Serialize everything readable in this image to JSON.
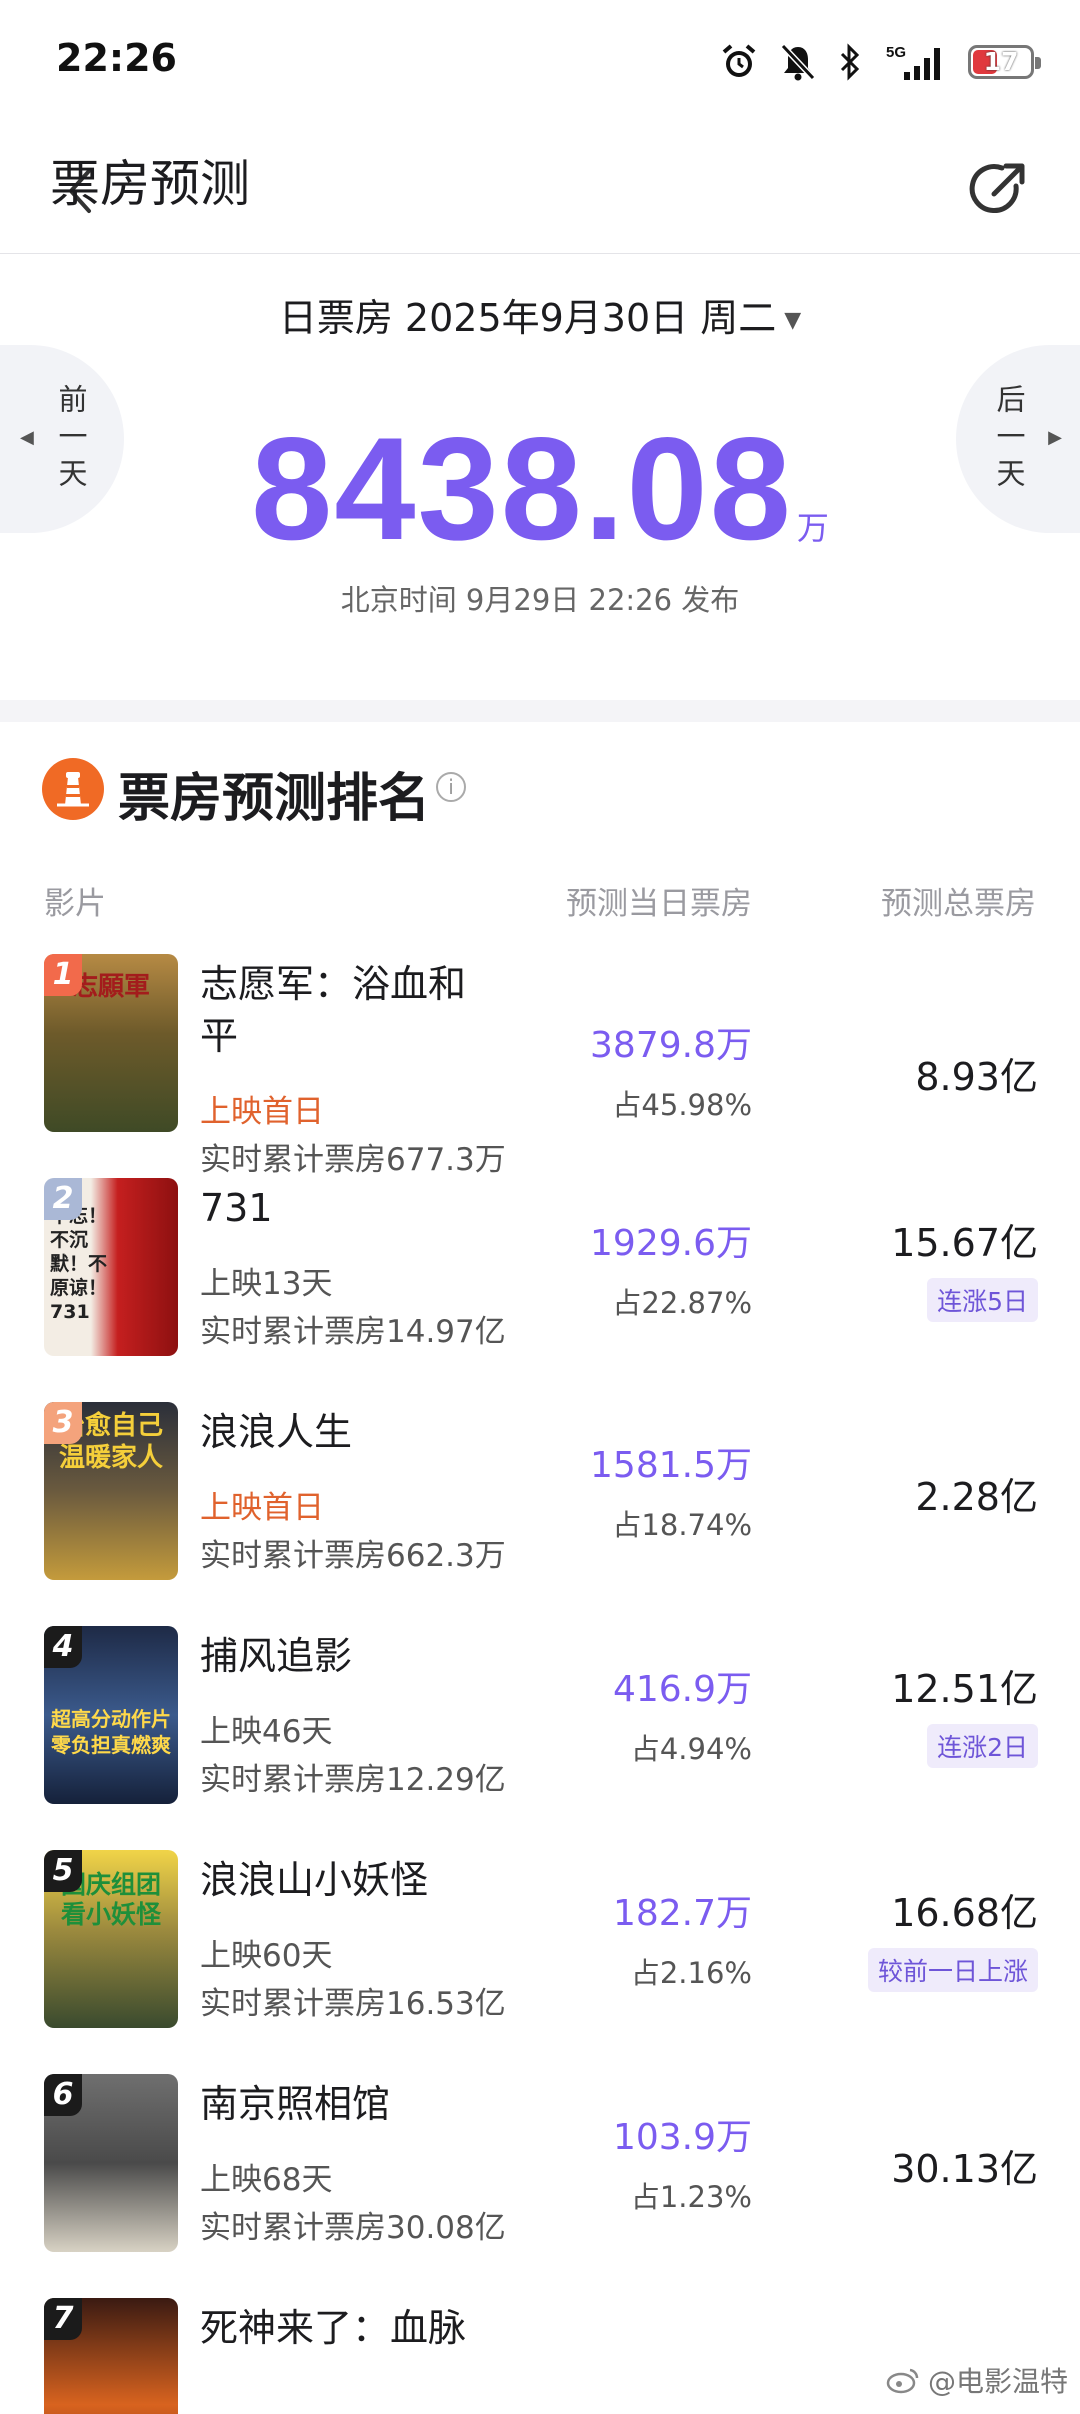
{
  "status_bar": {
    "time": "22:26",
    "network": "5G",
    "battery": "17"
  },
  "nav": {
    "title": "票房预测"
  },
  "summary": {
    "date_label": "日票房 2025年9月30日 周二",
    "prev_label": "前一天",
    "next_label": "后一天",
    "amount": "8438.08",
    "unit": "万",
    "publish_time": "北京时间 9月29日 22:26 发布"
  },
  "ranking": {
    "title": "票房预测排名",
    "col_film": "影片",
    "col_today": "预测当日票房",
    "col_total": "预测总票房",
    "items": [
      {
        "rank": "1",
        "title": "志愿军：浴血和平",
        "status": "上映首日",
        "cumulative": "实时累计票房677.3万",
        "today": "3879.8万",
        "share": "占45.98%",
        "total": "8.93亿",
        "badge": "",
        "poster_text": "志願軍"
      },
      {
        "rank": "2",
        "title": "731",
        "status": "上映13天",
        "cumulative": "实时累计票房14.97亿",
        "today": "1929.6万",
        "share": "占22.87%",
        "total": "15.67亿",
        "badge": "连涨5日",
        "poster_text": "不忘！不沉默！不原谅！ 731"
      },
      {
        "rank": "3",
        "title": "浪浪人生",
        "status": "上映首日",
        "cumulative": "实时累计票房662.3万",
        "today": "1581.5万",
        "share": "占18.74%",
        "total": "2.28亿",
        "badge": "",
        "poster_text": "治愈自己 温暖家人"
      },
      {
        "rank": "4",
        "title": "捕风追影",
        "status": "上映46天",
        "cumulative": "实时累计票房12.29亿",
        "today": "416.9万",
        "share": "占4.94%",
        "total": "12.51亿",
        "badge": "连涨2日",
        "poster_text": "超高分动作片 零负担真燃爽"
      },
      {
        "rank": "5",
        "title": "浪浪山小妖怪",
        "status": "上映60天",
        "cumulative": "实时累计票房16.53亿",
        "today": "182.7万",
        "share": "占2.16%",
        "total": "16.68亿",
        "badge": "较前一日上涨",
        "poster_text": "国庆组团 看小妖怪"
      },
      {
        "rank": "6",
        "title": "南京照相馆",
        "status": "上映68天",
        "cumulative": "实时累计票房30.08亿",
        "today": "103.9万",
        "share": "占1.23%",
        "total": "30.13亿",
        "badge": "",
        "poster_text": ""
      },
      {
        "rank": "7",
        "title": "死神来了：血脉",
        "status": "",
        "cumulative": "",
        "today": "",
        "share": "",
        "total": "",
        "badge": "",
        "poster_text": ""
      }
    ]
  },
  "watermark": "@电影温特",
  "colors": {
    "accent": "#7b5cf0",
    "premiere": "#e0622d",
    "logo": "#f06a25"
  }
}
